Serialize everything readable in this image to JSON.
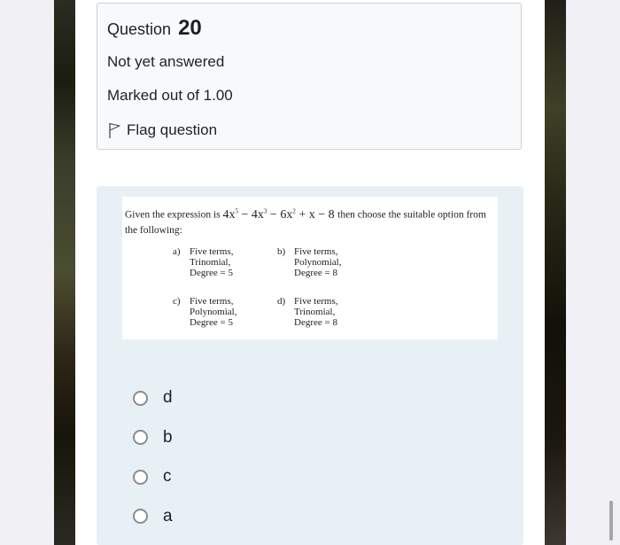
{
  "question_info": {
    "title_prefix": "Question",
    "number": "20",
    "state": "Not yet answered",
    "grade": "Marked out of 1.00",
    "flag_label": "Flag question",
    "flag_icon": "flag-outline-icon"
  },
  "question_image": {
    "intro": "Given the expression is",
    "expression": {
      "t1": "4x",
      "e1": "5",
      "t2": " − 4x",
      "e2": "3",
      "t3": " − 6x",
      "e3": "2",
      "t4": " + x − 8"
    },
    "outro": "then choose the suitable option from the following:",
    "options": [
      {
        "label": "a)",
        "lines": [
          "Five terms,",
          "Trinomial,",
          "Degree = 5"
        ]
      },
      {
        "label": "b)",
        "lines": [
          "Five terms,",
          "Polynomial,",
          "Degree = 8"
        ]
      },
      {
        "label": "c)",
        "lines": [
          "Five terms,",
          "Polynomial,",
          "Degree = 5"
        ]
      },
      {
        "label": "d)",
        "lines": [
          "Five terms,",
          "Trinomial,",
          "Degree = 8"
        ]
      }
    ]
  },
  "answers": [
    {
      "label": "d",
      "selected": false
    },
    {
      "label": "b",
      "selected": false
    },
    {
      "label": "c",
      "selected": false
    },
    {
      "label": "a",
      "selected": false
    }
  ],
  "colors": {
    "formulation_bg": "#e7f0f5",
    "info_bg": "#f8f9fa"
  }
}
